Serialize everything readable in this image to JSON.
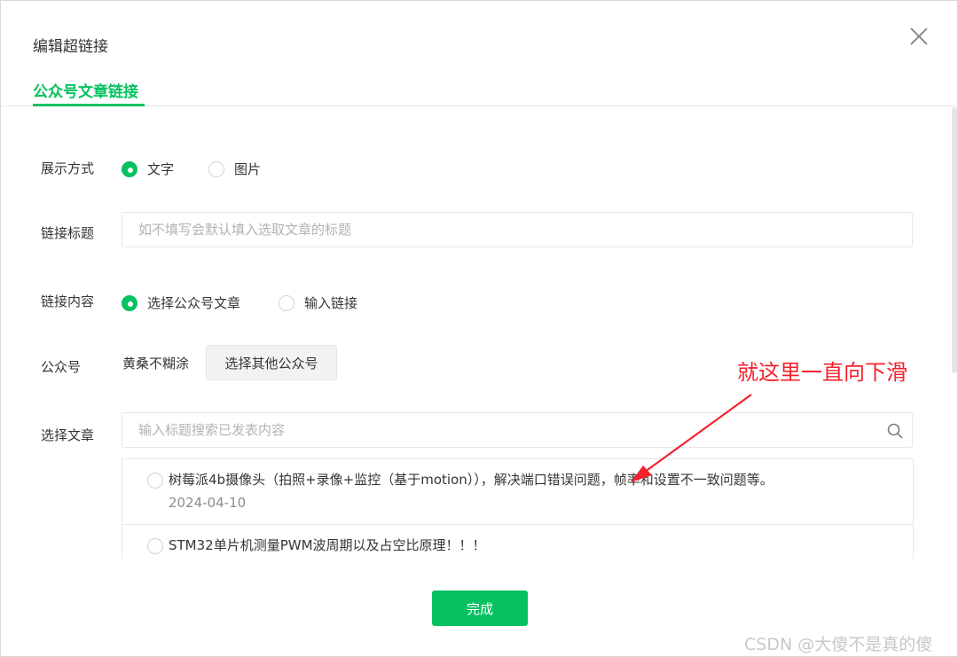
{
  "dialog": {
    "title": "编辑超链接",
    "tab": "公众号文章链接"
  },
  "display_mode": {
    "label": "展示方式",
    "options": [
      "文字",
      "图片"
    ],
    "selected": "文字"
  },
  "link_title": {
    "label": "链接标题",
    "placeholder": "如不填写会默认填入选取文章的标题"
  },
  "link_content": {
    "label": "链接内容",
    "options": [
      "选择公众号文章",
      "输入链接"
    ],
    "selected": "选择公众号文章"
  },
  "account": {
    "label": "公众号",
    "name": "黄桑不糊涂",
    "select_other_label": "选择其他公众号"
  },
  "article": {
    "label": "选择文章",
    "search_placeholder": "输入标题搜索已发表内容",
    "items": [
      {
        "title": "树莓派4b摄像头（拍照+录像+监控（基于motion）），解决端口错误问题，帧率和设置不一致问题等。",
        "date": "2024-04-10"
      },
      {
        "title": "STM32单片机测量PWM波周期以及占空比原理！！！",
        "date": ""
      }
    ]
  },
  "annotation": "就这里一直向下滑",
  "done_label": "完成",
  "watermark": "CSDN @大傻不是真的傻",
  "colors": {
    "accent": "#07c160",
    "annotation": "#f5222d"
  }
}
